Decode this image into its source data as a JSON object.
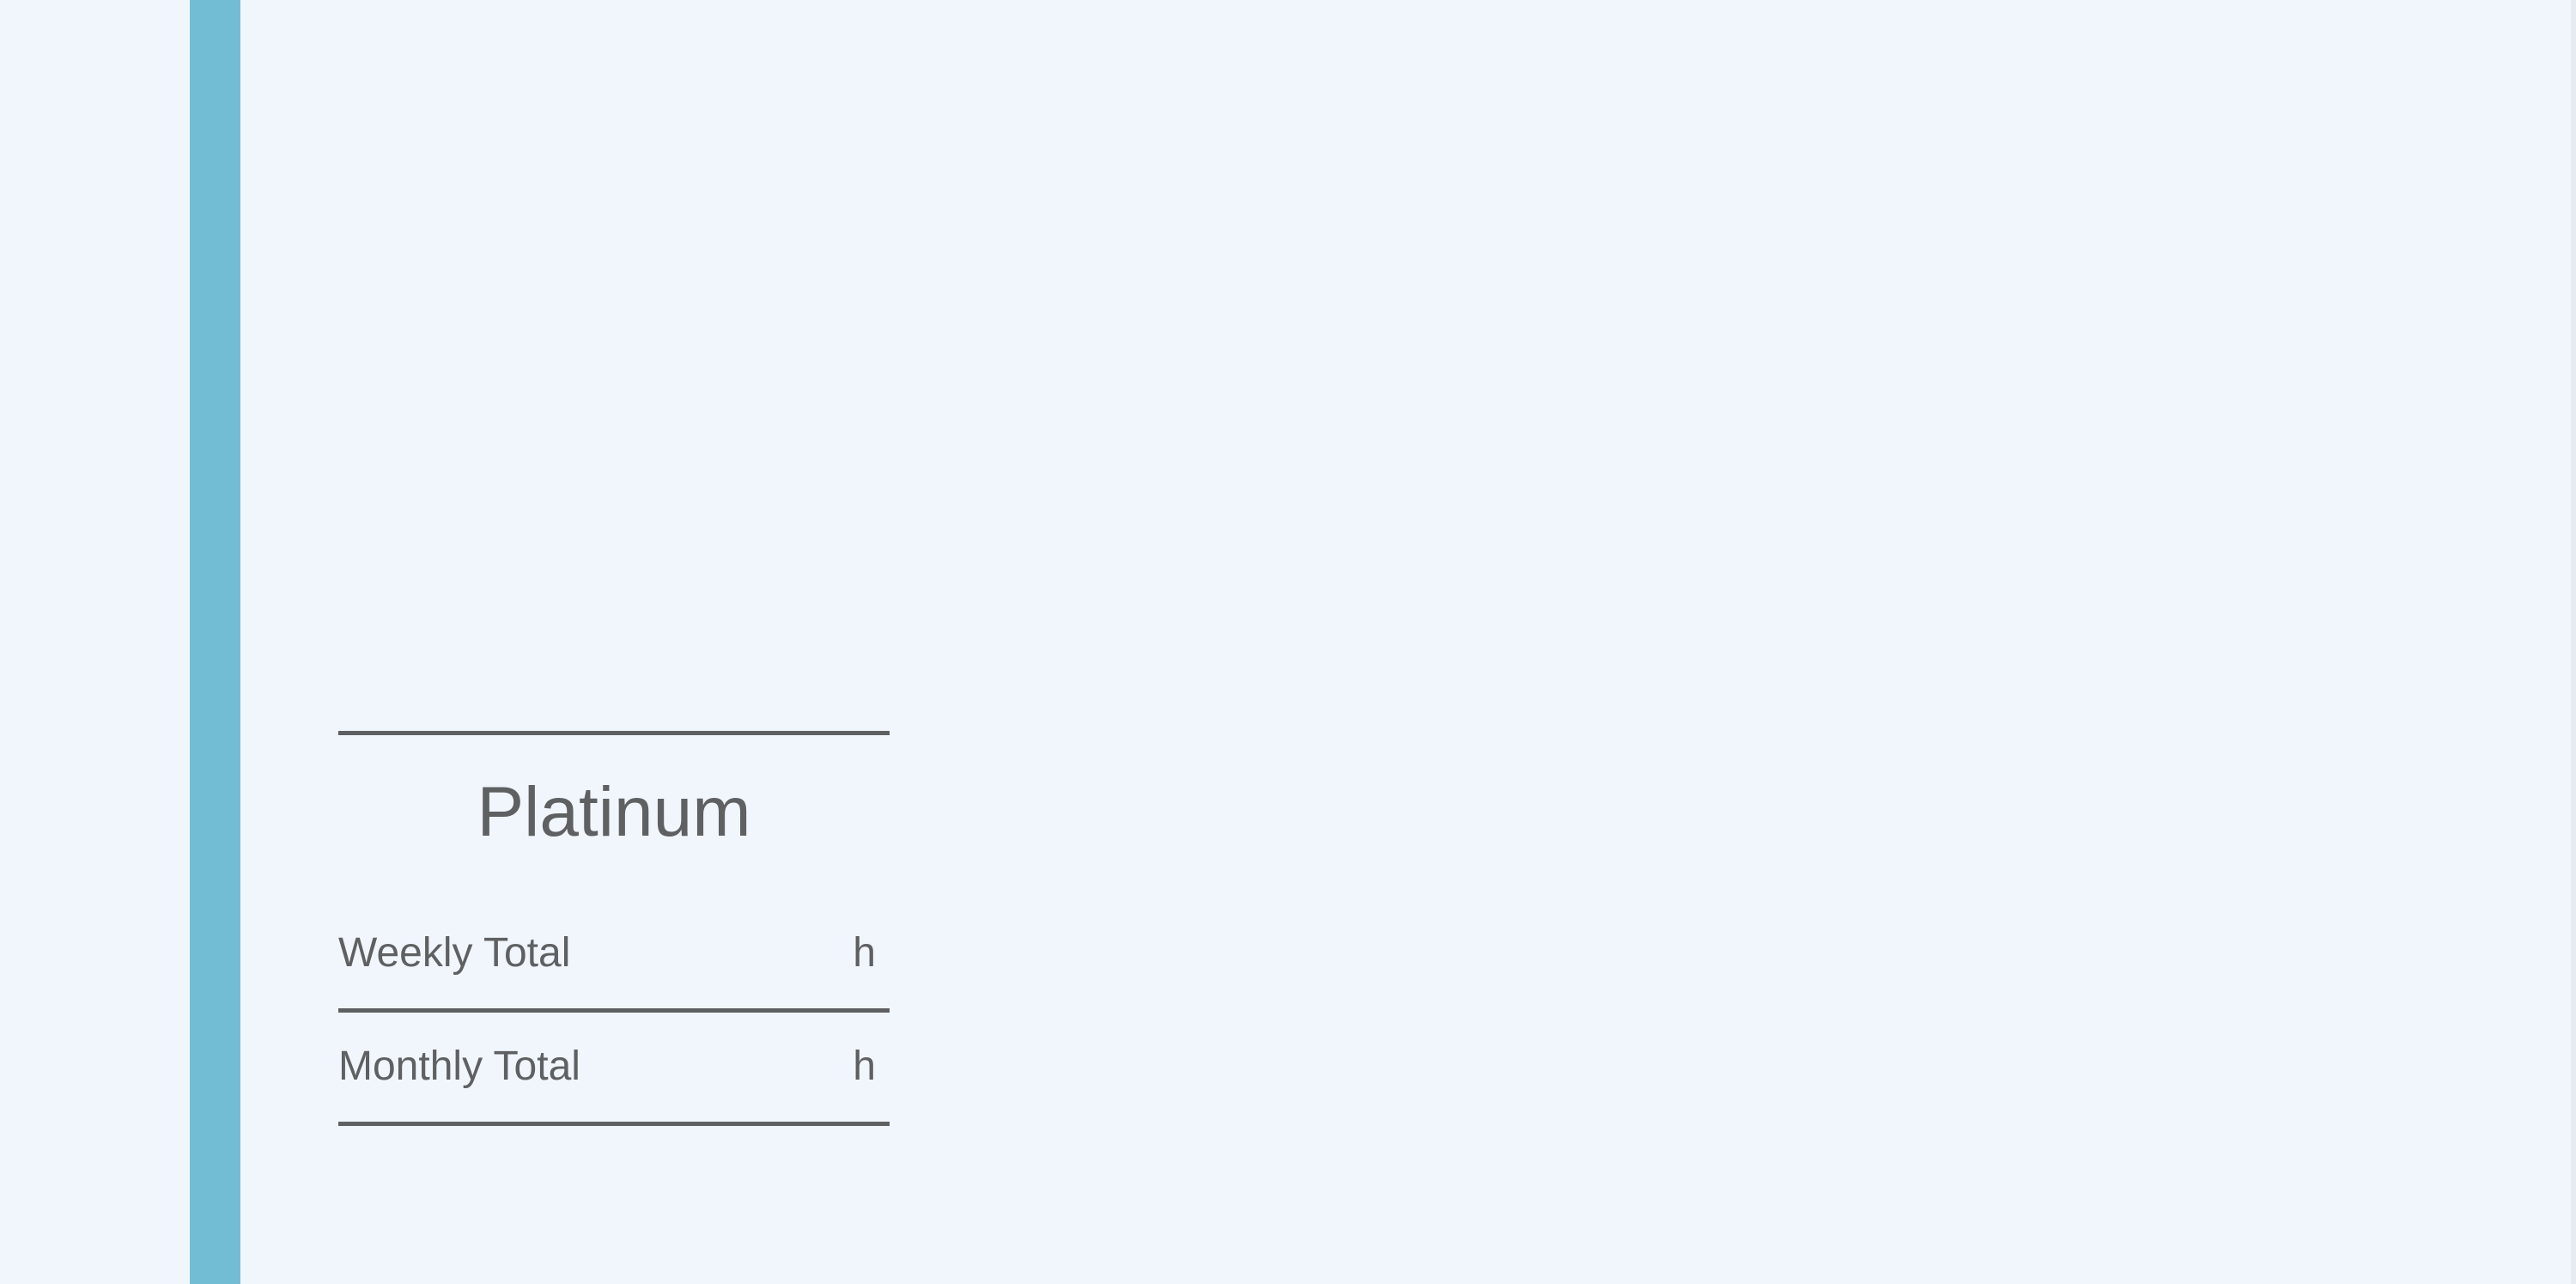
{
  "colors": {
    "background": "#f1f6fd",
    "accent_bar": "#72bdd4",
    "text": "#5f6062",
    "rule": "#5f6062"
  },
  "summary": {
    "plan_name": "Platinum",
    "rows": [
      {
        "label": "Weekly Total",
        "value": "",
        "unit": "h"
      },
      {
        "label": "Monthly Total",
        "value": "",
        "unit": "h"
      }
    ]
  }
}
